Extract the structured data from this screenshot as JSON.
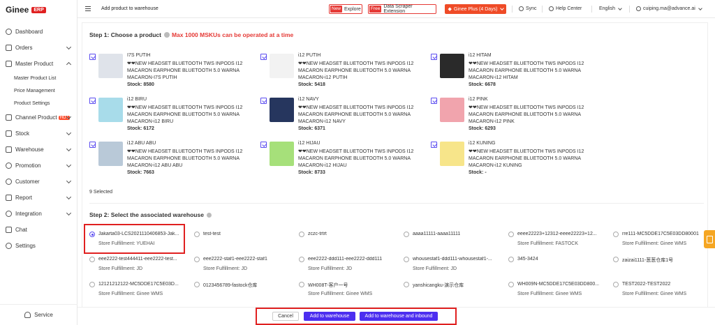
{
  "sidebar": {
    "brand": "Ginee",
    "badge": "ERP",
    "items": [
      {
        "label": "Dashboard",
        "icon": "dashboard-icon"
      },
      {
        "label": "Orders",
        "icon": "orders-icon"
      },
      {
        "label": "Master Product",
        "icon": "master-product-icon"
      },
      {
        "label": "Channel Product",
        "icon": "channel-product-icon",
        "badge": "HOT"
      },
      {
        "label": "Stock",
        "icon": "stock-icon"
      },
      {
        "label": "Warehouse",
        "icon": "warehouse-icon"
      },
      {
        "label": "Promotion",
        "icon": "promotion-icon"
      },
      {
        "label": "Customer",
        "icon": "customer-icon"
      },
      {
        "label": "Report",
        "icon": "report-icon"
      },
      {
        "label": "Integration",
        "icon": "integration-icon"
      },
      {
        "label": "Chat",
        "icon": "chat-icon"
      },
      {
        "label": "Settings",
        "icon": "settings-icon"
      }
    ],
    "sub_items": [
      "Master Product List",
      "Price Management",
      "Product Settings"
    ],
    "service": "Service"
  },
  "topbar": {
    "page_title": "Add product to warehouse",
    "explore_tag": "New",
    "explore_label": "Explore",
    "scraper_tag": "Free",
    "scraper_label": "Data Scraper Extension",
    "plan_label": "Ginee Plus (4 Days)",
    "sync": "Sync",
    "help": "Help Center",
    "language": "English",
    "user": "cuiping.ma@advance.ai"
  },
  "step1": {
    "title": "Step 1: Choose a product",
    "warning": "Max 1000 MSKUs can be operated at a time"
  },
  "products": [
    {
      "name": "I7S PUTIH",
      "desc": "❤❤NEW HEADSET BLUETOOTH TWS INPODS I12 MACARON EARPHONE BLUETOOTH 5.0 WARNA MACARON-I7S PUTIH",
      "stock_label": "Stock:",
      "stock": "8580",
      "color": "#dfe3ea"
    },
    {
      "name": "i12 PUTIH",
      "desc": "❤❤NEW HEADSET BLUETOOTH TWS INPODS I12 MACARON EARPHONE BLUETOOTH 5.0 WARNA MACARON-i12 PUTIH",
      "stock_label": "Stock:",
      "stock": "5418",
      "color": "#f2f2f2"
    },
    {
      "name": "i12 HITAM",
      "desc": "❤❤NEW HEADSET BLUETOOTH TWS INPODS I12 MACARON EARPHONE BLUETOOTH 5.0 WARNA MACARON-i12 HITAM",
      "stock_label": "Stock:",
      "stock": "6678",
      "color": "#2a2a2a"
    },
    {
      "name": "i12 BIRU",
      "desc": "❤❤NEW HEADSET BLUETOOTH TWS INPODS I12 MACARON EARPHONE BLUETOOTH 5.0 WARNA MACARON-i12 BIRU",
      "stock_label": "Stock:",
      "stock": "6172",
      "color": "#a8dcea"
    },
    {
      "name": "i12 NAVY",
      "desc": "❤❤NEW HEADSET BLUETOOTH TWS INPODS I12 MACARON EARPHONE BLUETOOTH 5.0 WARNA MACARON-i12 NAVY",
      "stock_label": "Stock:",
      "stock": "6371",
      "color": "#26365e"
    },
    {
      "name": "i12 PINK",
      "desc": "❤❤NEW HEADSET BLUETOOTH TWS INPODS I12 MACARON EARPHONE BLUETOOTH 5.0 WARNA MACARON-i12 PINK",
      "stock_label": "Stock:",
      "stock": "6293",
      "color": "#f1a4ad"
    },
    {
      "name": "i12 ABU ABU",
      "desc": "❤❤NEW HEADSET BLUETOOTH TWS INPODS I12 MACARON EARPHONE BLUETOOTH 5.0 WARNA MACARON-i12 ABU ABU",
      "stock_label": "Stock:",
      "stock": "7663",
      "color": "#b9c9d8"
    },
    {
      "name": "i12 HIJAU",
      "desc": "❤❤NEW HEADSET BLUETOOTH TWS INPODS I12 MACARON EARPHONE BLUETOOTH 5.0 WARNA MACARON-i12 HIJAU",
      "stock_label": "Stock:",
      "stock": "8733",
      "color": "#a6e07a"
    },
    {
      "name": "i12 KUNING",
      "desc": "❤❤NEW HEADSET BLUETOOTH TWS INPODS I12 MACARON EARPHONE BLUETOOTH 5.0 WARNA MACARON-i12 KUNING",
      "stock_label": "Stock:",
      "stock": "-",
      "color": "#f7e58a"
    }
  ],
  "selected_count": "9 Selected",
  "step2": {
    "title": "Step 2: Select the associated warehouse"
  },
  "warehouses": [
    {
      "name": "Jakarta03-LCS20211104068​53-Jak...",
      "sub": "Store Fulfillment: YUEHAI",
      "selected": true
    },
    {
      "name": "test-test",
      "sub": ""
    },
    {
      "name": "zczc-trtrt",
      "sub": ""
    },
    {
      "name": "aaaa11111-aaaa11111",
      "sub": ""
    },
    {
      "name": "eeee22223+12312-eeee22223+12...",
      "sub": "Store Fulfillment: FASTOCK"
    },
    {
      "name": "rre111-MC5DDE17C5E03DD80001",
      "sub": "Store Fulfillment: Ginee WMS"
    },
    {
      "name": "eee2222-test444411-eee2222-test...",
      "sub": "Store Fulfillment: JD"
    },
    {
      "name": "eee2222-staf1-eee2222-staf1",
      "sub": "Store Fulfillment: JD"
    },
    {
      "name": "eee2222-ddd111-eee2222-ddd111",
      "sub": "Store Fulfillment: JD"
    },
    {
      "name": "whousestaf1-ddd111-whousestaf1-...",
      "sub": "Store Fulfillment: JD"
    },
    {
      "name": "345-3424",
      "sub": ""
    },
    {
      "name": "zaizai1111-葱葱仓库1号",
      "sub": ""
    },
    {
      "name": "12121212122-MC5DDE17C5E03D...",
      "sub": "Store Fulfillment: Ginee WMS"
    },
    {
      "name": "0123456789-fastock仓库",
      "sub": ""
    },
    {
      "name": "WH008T-客户一号",
      "sub": "Store Fulfillment: Ginee WMS"
    },
    {
      "name": "yanshicangku-演示仓库",
      "sub": ""
    },
    {
      "name": "WH009N-MC5DDE17C5E03DD800...",
      "sub": "Store Fulfillment: Ginee WMS"
    },
    {
      "name": "TEST2022-TEST2022",
      "sub": "Store Fulfillment: Ginee WMS"
    }
  ],
  "footer": {
    "cancel": "Cancel",
    "add": "Add to warehouse",
    "add_inbound": "Add to warehouse and inbound"
  }
}
